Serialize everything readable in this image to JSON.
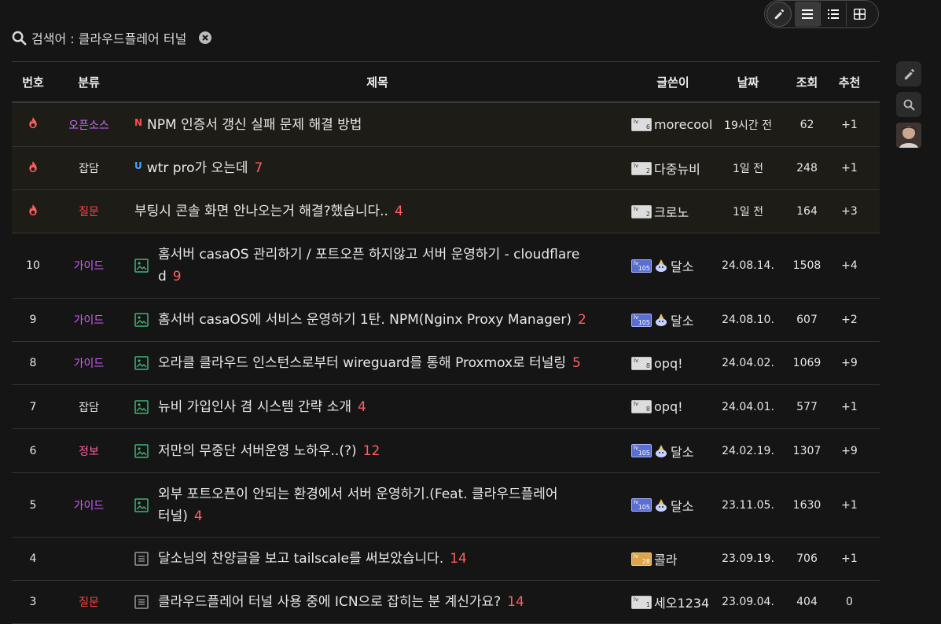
{
  "search": {
    "label": "검색어 : 클라우드플레어 터널"
  },
  "header": {
    "no": "번호",
    "category": "분류",
    "title": "제목",
    "author": "글쓴이",
    "date": "날짜",
    "views": "조회",
    "recommend": "추천"
  },
  "colors": {
    "hot": "#ff5e5e",
    "guide": "#d35bff",
    "opensource": "#c76bff",
    "question": "#ff4444",
    "info": "#ff5ea8",
    "chat": "#e6e6e6",
    "comment": "#ff5e5e"
  },
  "rows": [
    {
      "no_icon": "fire-icon",
      "category": "오픈소스",
      "cat_color": "#c76bff",
      "badge": "N",
      "title": "NPM 인증서 갱신 실패 문제 해결 방법",
      "comments": "",
      "author": "morecool",
      "level": "6",
      "level_style": "gray",
      "date": "19시간 전",
      "views": "62",
      "rec": "+1",
      "notice": true
    },
    {
      "no_icon": "fire-icon",
      "category": "잡담",
      "cat_color": "#e6e6e6",
      "badge": "U",
      "title": "wtr pro가 오는데",
      "comments": "7",
      "author": "다중뉴비",
      "level": "2",
      "level_style": "gray",
      "date": "1일 전",
      "views": "248",
      "rec": "+1",
      "notice": true
    },
    {
      "no_icon": "fire-icon",
      "category": "질문",
      "cat_color": "#ff4444",
      "badge": "",
      "title": "부팅시 콘솔 화면 안나오는거 해결?했습니다..",
      "comments": "4",
      "author": "크로노",
      "level": "2",
      "level_style": "gray",
      "date": "1일 전",
      "views": "164",
      "rec": "+3",
      "notice": true
    },
    {
      "no": "10",
      "category": "가이드",
      "cat_color": "#d35bff",
      "icon": "image-icon",
      "title": "홈서버 casaOS 관리하기 / 포트오픈 하지않고 서버 운영하기 - cloudflare",
      "title2": "d",
      "comments": "9",
      "author": "달소",
      "level": "105",
      "level_style": "blue",
      "mascot": true,
      "date": "24.08.14.",
      "views": "1508",
      "rec": "+4"
    },
    {
      "no": "9",
      "category": "가이드",
      "cat_color": "#d35bff",
      "icon": "image-icon",
      "title": "홈서버 casaOS에 서비스 운영하기 1탄. NPM(Nginx Proxy Manager)",
      "comments": "2",
      "author": "달소",
      "level": "105",
      "level_style": "blue",
      "mascot": true,
      "date": "24.08.10.",
      "views": "607",
      "rec": "+2"
    },
    {
      "no": "8",
      "category": "가이드",
      "cat_color": "#d35bff",
      "icon": "image-icon",
      "title": "오라클 클라우드 인스턴스로부터 wireguard를 통해 Proxmox로 터널링",
      "comments": "5",
      "author": "opq!",
      "level": "8",
      "level_style": "gray",
      "date": "24.04.02.",
      "views": "1069",
      "rec": "+9"
    },
    {
      "no": "7",
      "category": "잡담",
      "cat_color": "#e6e6e6",
      "icon": "image-icon",
      "title": "뉴비 가입인사 겸 시스템 간략 소개",
      "comments": "4",
      "author": "opq!",
      "level": "8",
      "level_style": "gray",
      "date": "24.04.01.",
      "views": "577",
      "rec": "+1"
    },
    {
      "no": "6",
      "category": "정보",
      "cat_color": "#ff5ea8",
      "icon": "image-icon",
      "title": "저만의 무중단 서버운영 노하우..(?)",
      "comments": "12",
      "author": "달소",
      "level": "105",
      "level_style": "blue",
      "mascot": true,
      "date": "24.02.19.",
      "views": "1307",
      "rec": "+9"
    },
    {
      "no": "5",
      "category": "가이드",
      "cat_color": "#d35bff",
      "icon": "image-icon",
      "title": "외부 포트오픈이 안되는 환경에서 서버 운영하기.(Feat. 클라우드플레어",
      "title2": "터널)",
      "comments": "4",
      "author": "달소",
      "level": "105",
      "level_style": "blue",
      "mascot": true,
      "date": "23.11.05.",
      "views": "1630",
      "rec": "+1"
    },
    {
      "no": "4",
      "category": "",
      "cat_color": "#e6e6e6",
      "icon": "doc-icon",
      "title": "달소님의 찬양글을 보고 tailscale를 써보았습니다.",
      "comments": "14",
      "author": "콜라",
      "level": "28",
      "level_style": "gold",
      "date": "23.09.19.",
      "views": "706",
      "rec": "+1"
    },
    {
      "no": "3",
      "category": "질문",
      "cat_color": "#ff4444",
      "icon": "doc-icon",
      "title": "클라우드플레어 터널 사용 중에 ICN으로 잡히는 분 계신가요?",
      "comments": "14",
      "author": "세오1234",
      "level": "1",
      "level_style": "gray",
      "date": "23.09.04.",
      "views": "404",
      "rec": "0"
    }
  ]
}
